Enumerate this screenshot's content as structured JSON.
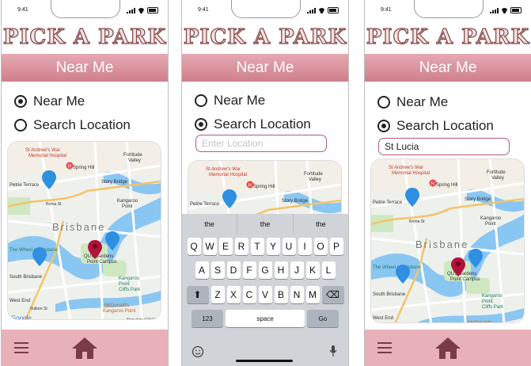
{
  "status": {
    "time": "9:41"
  },
  "app": {
    "title": "PICK A PARK",
    "banner": "Near Me"
  },
  "options": {
    "near_me": "Near Me",
    "search_location": "Search Location"
  },
  "screens": [
    {
      "selected": "near_me"
    },
    {
      "selected": "search_location",
      "input_placeholder": "Enter Location",
      "input_value": ""
    },
    {
      "selected": "search_location",
      "input_placeholder": "Enter Location",
      "input_value": "St Lucia"
    }
  ],
  "map": {
    "hospital": "St Andrew's War Memorial Hospital",
    "spring_hill": "Spring Hill",
    "fortitude_valley": "Fortitude Valley",
    "petrie_terrace": "Petrie Terrace",
    "story_bridge": "Story Bridge",
    "roma_st": "Roma St",
    "kangaroo_point": "Kangaroo Point",
    "brisbane": "Brisbane",
    "wheel": "The Wheel of Brisbane",
    "qut": "QUT Gardens Point Campus",
    "south_brisbane": "South Brisbane",
    "kp_cliffs": "Kangaroo Point Cliffs Park",
    "west_end": "West End",
    "vulture_st": "Vulture St",
    "mcdonalds": "McDonald's Kangaroo Point",
    "google": "Google",
    "map_data": "Map data ©2019"
  },
  "keyboard": {
    "suggestions": [
      "the",
      "the",
      "the"
    ],
    "row1": [
      "Q",
      "W",
      "E",
      "R",
      "T",
      "Y",
      "U",
      "I",
      "O",
      "P"
    ],
    "row2": [
      "A",
      "S",
      "D",
      "F",
      "G",
      "H",
      "J",
      "K",
      "L"
    ],
    "row3": [
      "Z",
      "X",
      "C",
      "V",
      "B",
      "N",
      "M"
    ],
    "numbers": "123",
    "space": "space",
    "go": "Go"
  },
  "colors": {
    "banner": "#d98e99",
    "nav": "#e8b1ba",
    "pin_blue": "#2f8fe0",
    "pin_red": "#b3123a"
  },
  "icons": {
    "menu": "hamburger-icon",
    "home": "home-icon",
    "emoji": "emoji-icon",
    "mic": "microphone-icon",
    "shift": "shift-icon",
    "delete": "backspace-icon"
  }
}
